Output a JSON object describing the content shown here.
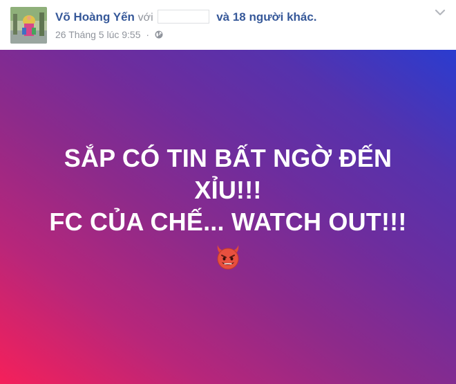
{
  "author": {
    "name": "Võ Hoàng Yến",
    "with_word": "với",
    "and_others": "và 18 người khác."
  },
  "meta": {
    "timestamp": "26 Tháng 5 lúc 9:55",
    "separator": "·",
    "privacy_icon": "globe-icon"
  },
  "menu_icon": "chevron-down-icon",
  "post": {
    "lines": [
      "SẮP CÓ TIN BẤT NGỜ ĐẾN",
      "XỈU!!!",
      "FC CỦA CHẾ... WATCH OUT!!!"
    ],
    "emoji": "smiling-devil-emoji"
  },
  "colors": {
    "link": "#365899",
    "meta": "#90949c",
    "gradient_start": "#f5205a",
    "gradient_end": "#2a3ccf"
  }
}
